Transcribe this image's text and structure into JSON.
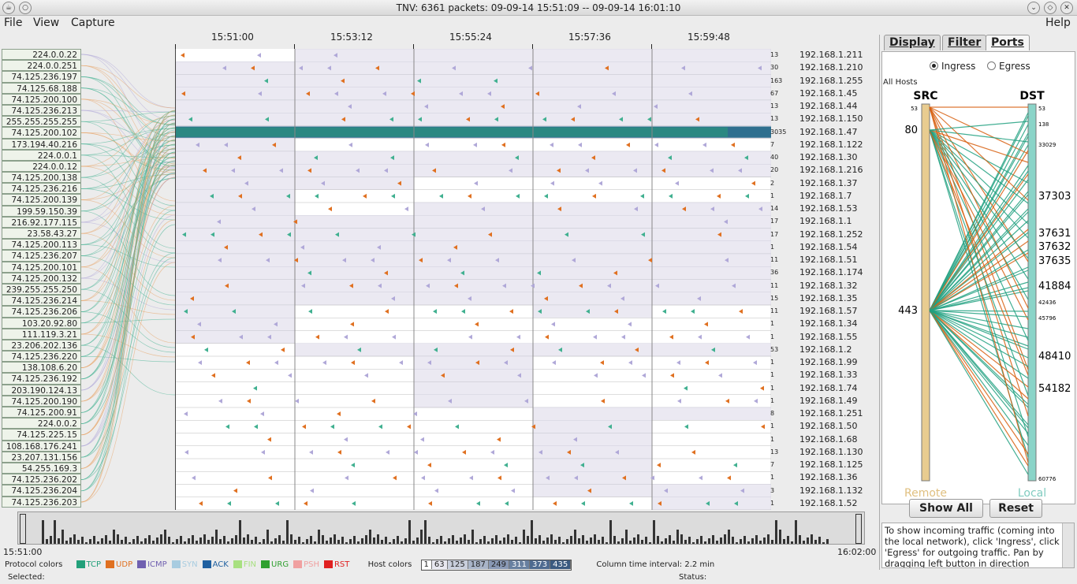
{
  "window": {
    "title": "TNV: 6361 packets: 09-09-14 15:51:09 -- 09-09-14 16:01:10"
  },
  "menu": {
    "file": "File",
    "view": "View",
    "capture": "Capture",
    "help": "Help"
  },
  "time_axis": [
    "15:51:00",
    "15:53:12",
    "15:55:24",
    "15:57:36",
    "15:59:48"
  ],
  "left_hosts": [
    "224.0.0.22",
    "224.0.0.251",
    "74.125.236.197",
    "74.125.68.188",
    "74.125.200.100",
    "74.125.236.213",
    "255.255.255.255",
    "74.125.200.102",
    "173.194.40.216",
    "224.0.0.1",
    "224.0.0.12",
    "74.125.200.138",
    "74.125.236.216",
    "74.125.200.139",
    "199.59.150.39",
    "216.92.177.115",
    "23.58.43.27",
    "74.125.200.113",
    "74.125.236.207",
    "74.125.200.101",
    "74.125.200.132",
    "239.255.255.250",
    "74.125.236.214",
    "74.125.236.206",
    "103.20.92.80",
    "111.119.3.21",
    "23.206.202.136",
    "74.125.236.220",
    "138.108.6.20",
    "74.125.236.192",
    "203.190.124.13",
    "74.125.200.190",
    "74.125.200.91",
    "224.0.0.2",
    "74.125.225.15",
    "108.168.176.241",
    "23.207.131.156",
    "54.255.169.3",
    "74.125.236.202",
    "74.125.236.204",
    "74.125.236.203"
  ],
  "right_hosts": [
    "192.168.1.211",
    "192.168.1.210",
    "192.168.1.255",
    "192.168.1.45",
    "192.168.1.44",
    "192.168.1.150",
    "192.168.1.47",
    "192.168.1.122",
    "192.168.1.30",
    "192.168.1.216",
    "192.168.1.37",
    "192.168.1.7",
    "192.168.1.53",
    "192.168.1.1",
    "192.168.1.252",
    "192.168.1.54",
    "192.168.1.51",
    "192.168.1.174",
    "192.168.1.32",
    "192.168.1.35",
    "192.168.1.57",
    "192.168.1.34",
    "192.168.1.55",
    "192.168.1.2",
    "192.168.1.99",
    "192.168.1.33",
    "192.168.1.74",
    "192.168.1.49",
    "192.168.1.251",
    "192.168.1.50",
    "192.168.1.68",
    "192.168.1.130",
    "192.168.1.125",
    "192.168.1.36",
    "192.168.1.132",
    "192.168.1.52"
  ],
  "right_counts": [
    "13",
    "30",
    "163",
    "67",
    "13",
    "13",
    "3035",
    "7",
    "40",
    "20",
    "2",
    "1",
    "14",
    "17",
    "17",
    "1",
    "11",
    "36",
    "11",
    "15",
    "11",
    "1",
    "1",
    "53",
    "1",
    "1",
    "1",
    "1",
    "8",
    "1",
    "1",
    "13",
    "7",
    "1",
    "3",
    "1"
  ],
  "range": {
    "start": "15:51:00",
    "end": "16:02:00"
  },
  "legend": {
    "protocol_label": "Protocol colors",
    "protocols": [
      {
        "name": "TCP",
        "color": "#22a07a"
      },
      {
        "name": "UDP",
        "color": "#e07020"
      },
      {
        "name": "ICMP",
        "color": "#7060b0"
      },
      {
        "name": "SYN",
        "color": "#a8cce0"
      },
      {
        "name": "ACK",
        "color": "#2060a0"
      },
      {
        "name": "FIN",
        "color": "#a8e080"
      },
      {
        "name": "URG",
        "color": "#30a030"
      },
      {
        "name": "PSH",
        "color": "#f0a0a0"
      },
      {
        "name": "RST",
        "color": "#e02020"
      }
    ],
    "host_label": "Host colors",
    "host_scale": [
      "1",
      "63",
      "125",
      "187",
      "249",
      "311",
      "373",
      "435"
    ],
    "interval": "Column time interval: 2.2 min"
  },
  "status": {
    "selected": "Selected:",
    "status": "Status:"
  },
  "panel": {
    "tabs": [
      "Display",
      "Filter",
      "Ports"
    ],
    "ingress": "Ingress",
    "egress": "Egress",
    "all_hosts": "All Hosts",
    "src": "SRC",
    "dst": "DST",
    "remote": "Remote",
    "local": "Local",
    "src_ports": [
      "53",
      "80",
      "443"
    ],
    "dst_ports": [
      "53",
      "138",
      "33029",
      "37303",
      "37631",
      "37632",
      "37635",
      "41884",
      "42436",
      "45796",
      "48410",
      "54182",
      "60776"
    ],
    "show_all": "Show All",
    "reset": "Reset",
    "help": "To show incoming traffic (coming into the local network), click 'Ingress', click 'Egress' for outgoing traffic. Pan by dragging left button in direction"
  }
}
